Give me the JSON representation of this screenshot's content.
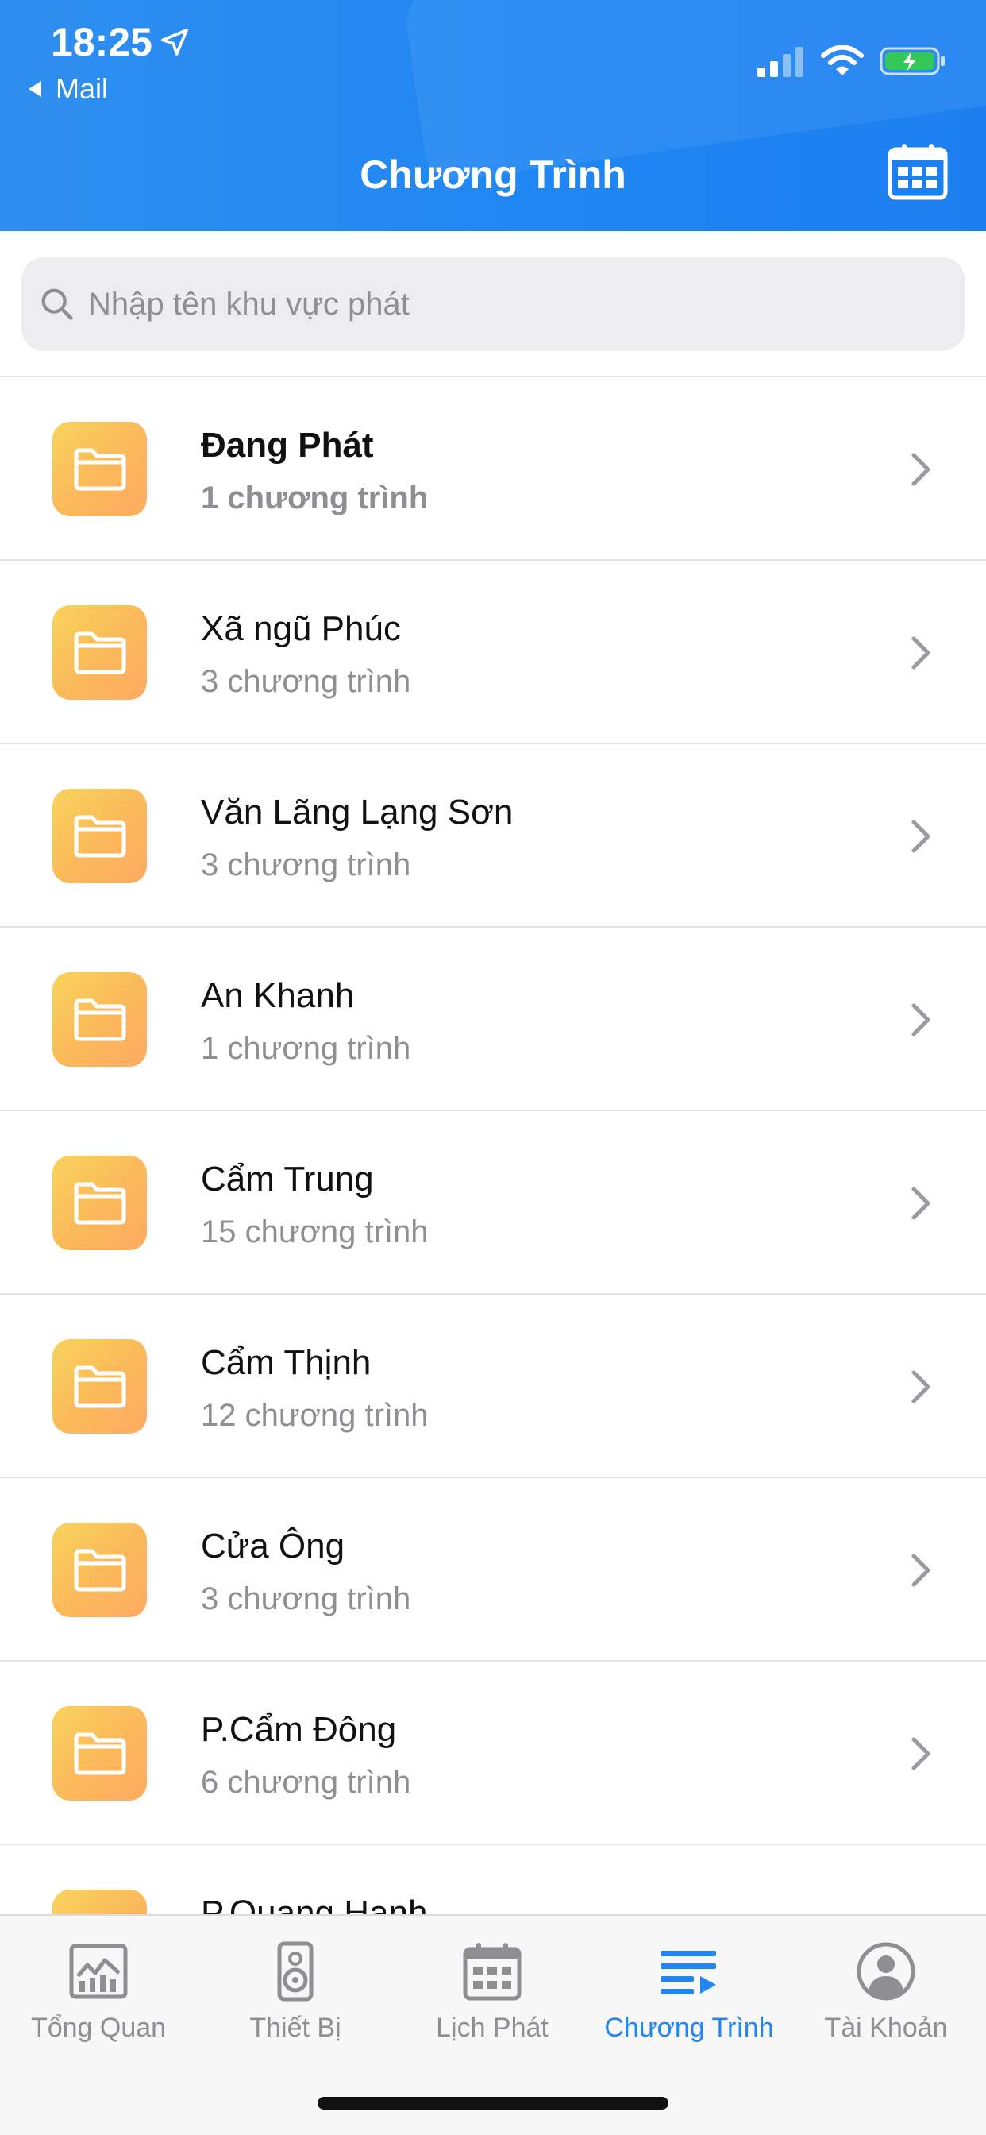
{
  "status_bar": {
    "time": "18:25",
    "back_app": "Mail",
    "icons": [
      "location-arrow-icon",
      "signal-icon",
      "wifi-icon",
      "battery-charging-icon"
    ],
    "battery_color": "#34c759"
  },
  "header": {
    "title": "Chương Trình",
    "calendar_icon": "calendar-icon",
    "color": "#1f86f3"
  },
  "search": {
    "placeholder": "Nhập tên khu vực phát",
    "value": ""
  },
  "list": {
    "items": [
      {
        "name": "Đang Phát",
        "count": "1 chương trình",
        "bold": true
      },
      {
        "name": "Xã ngũ Phúc",
        "count": "3 chương trình"
      },
      {
        "name": "Văn Lãng Lạng Sơn",
        "count": "3 chương trình"
      },
      {
        "name": "An Khanh",
        "count": "1 chương trình"
      },
      {
        "name": "Cẩm Trung",
        "count": "15 chương trình"
      },
      {
        "name": "Cẩm Thịnh",
        "count": "12 chương trình"
      },
      {
        "name": "Cửa Ông",
        "count": "3 chương trình"
      },
      {
        "name": "P.Cẩm Đông",
        "count": "6 chương trình"
      },
      {
        "name": "P.Quang Hanh",
        "count": ""
      }
    ],
    "item_icon": "folder-icon",
    "folder_color": "#fbbd5a"
  },
  "tabbar": {
    "tabs": [
      {
        "label": "Tổng Quan",
        "icon": "chart-icon"
      },
      {
        "label": "Thiết Bị",
        "icon": "speaker-icon"
      },
      {
        "label": "Lịch Phát",
        "icon": "calendar-icon"
      },
      {
        "label": "Chương Trình",
        "icon": "playlist-icon",
        "active": true
      },
      {
        "label": "Tài Khoản",
        "icon": "account-icon"
      }
    ],
    "active_color": "#1f86f3",
    "inactive_color": "#8e8e93"
  }
}
